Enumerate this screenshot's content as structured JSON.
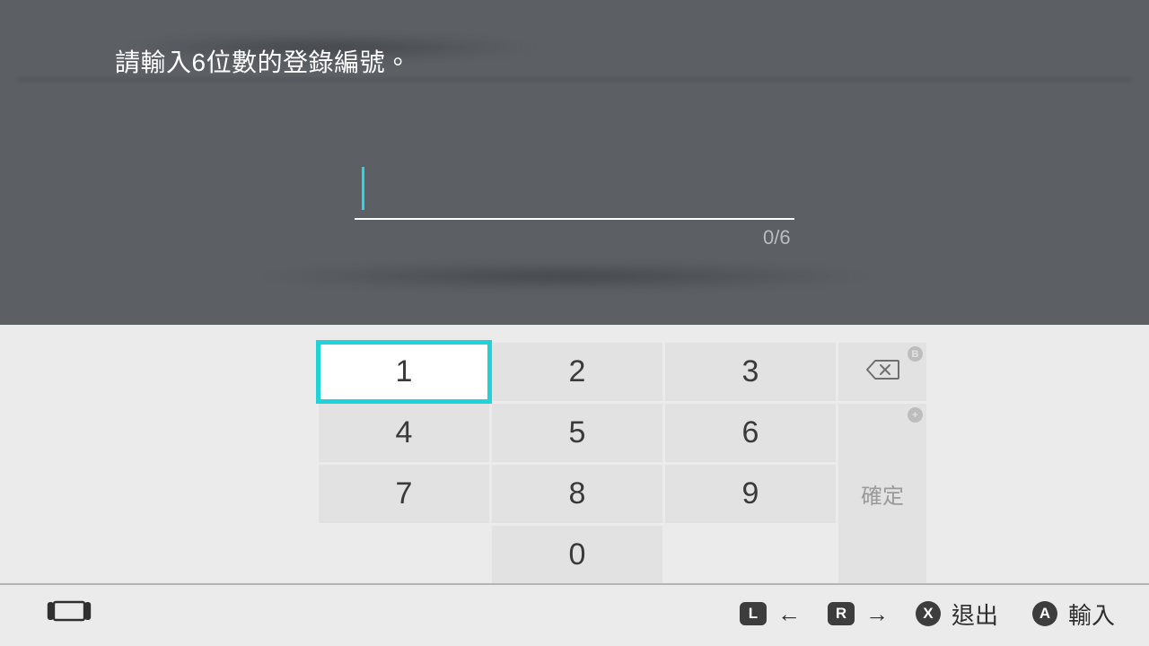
{
  "prompt_text": "請輸入6位數的登錄編號。",
  "input": {
    "value": "",
    "counter": "0/6"
  },
  "keypad": {
    "keys": [
      "1",
      "2",
      "3",
      "4",
      "5",
      "6",
      "7",
      "8",
      "9",
      "0"
    ],
    "selected": "1",
    "confirm_label": "確定",
    "backspace_hint": "B",
    "confirm_hint": "+"
  },
  "footer": {
    "l_key": "L",
    "r_key": "R",
    "left_arrow": "←",
    "right_arrow": "→",
    "x_btn": "X",
    "a_btn": "A",
    "exit_label": "退出",
    "enter_label": "輸入"
  }
}
